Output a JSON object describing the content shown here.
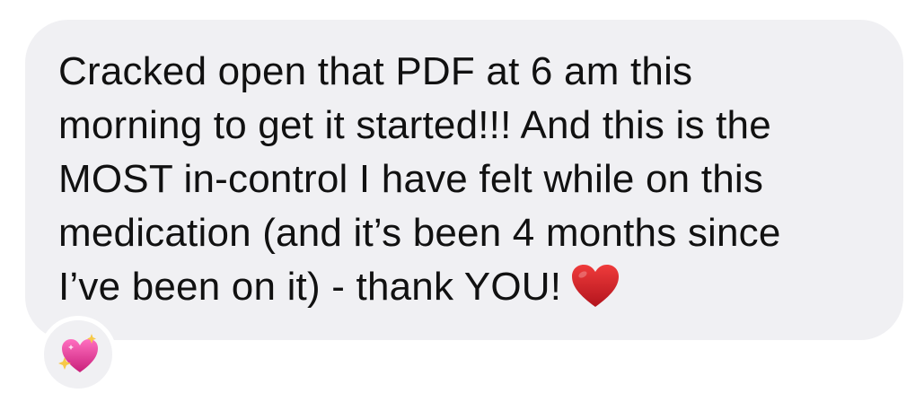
{
  "message": {
    "lines": [
      "Cracked open that PDF at 6 am this",
      "morning to get it started!!! And this is the",
      "MOST in-control I have felt while on this",
      "medication (and it’s been 4 months since",
      "I’ve been on it) - thank YOU!"
    ],
    "trailing_emoji": "red-heart-icon"
  },
  "reaction": {
    "emoji": "sparkling-heart-icon"
  },
  "colors": {
    "bubble_background": "#f0f0f3",
    "text": "#111111",
    "heart_red": "#d0202a",
    "reaction_pink": "#e4358f"
  }
}
